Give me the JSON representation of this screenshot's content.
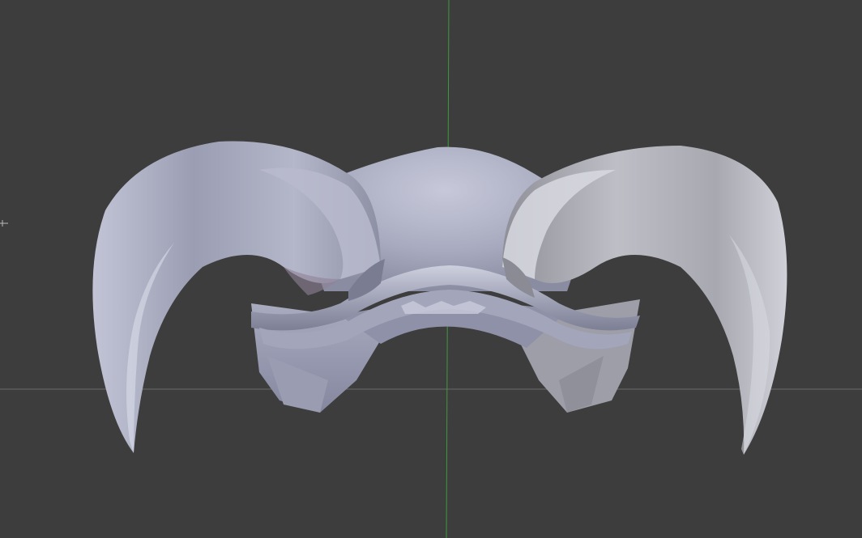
{
  "viewport": {
    "background_color": "#3d3d3d",
    "axis_x_color": "#6e6e6e",
    "axis_y_color": "#3f9a3f"
  },
  "model": {
    "base_color": "#a7a9bd",
    "highlight_color": "#d6d8e4",
    "shadow_color": "#6f7285",
    "dark_color": "#4b4d5c"
  },
  "icons": {
    "origin_marker": "crosshair-icon"
  }
}
